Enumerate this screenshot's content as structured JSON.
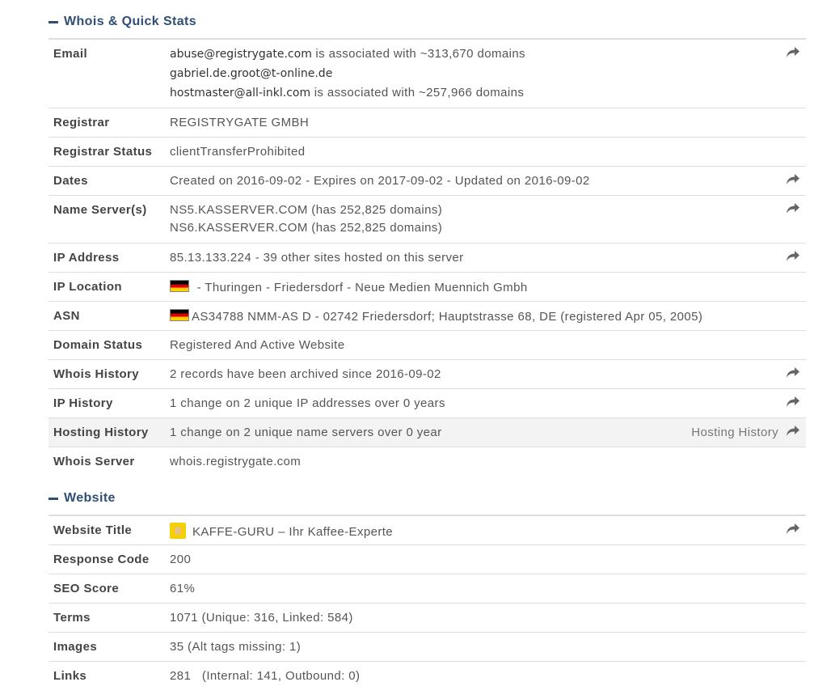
{
  "whois": {
    "title": "Whois & Quick Stats",
    "rows": {
      "email": {
        "label": "Email",
        "addr1": "abuse@registrygate.com",
        "assoc1": " is associated with ~313,670 domains",
        "addr2": "gabriel.de.groot@t-online.de",
        "addr3": "hostmaster@all-inkl.com",
        "assoc3": " is associated with ~257,966 domains"
      },
      "registrar": {
        "label": "Registrar",
        "value": "REGISTRYGATE GMBH"
      },
      "registrar_status": {
        "label": "Registrar Status",
        "value": "clientTransferProhibited"
      },
      "dates": {
        "label": "Dates",
        "value": "Created on 2016-09-02 - Expires on 2017-09-02 - Updated on 2016-09-02"
      },
      "name_servers": {
        "label": "Name Server(s)",
        "ns1": "NS5.KASSERVER.COM (has 252,825 domains)",
        "ns2": "NS6.KASSERVER.COM (has 252,825 domains)"
      },
      "ip_address": {
        "label": "IP Address",
        "value": "85.13.133.224 - 39 other sites hosted on this server"
      },
      "ip_location": {
        "label": "IP Location",
        "value": " - Thuringen - Friedersdorf - Neue Medien Muennich Gmbh",
        "flag": "germany-flag"
      },
      "asn": {
        "label": "ASN",
        "value": "AS34788 NMM-AS D - 02742 Friedersdorf; Hauptstrasse 68, DE (registered Apr 05, 2005)",
        "flag": "germany-flag"
      },
      "domain_status": {
        "label": "Domain Status",
        "value": "Registered And Active Website"
      },
      "whois_history": {
        "label": "Whois History",
        "value": "2 records have been archived since 2016-09-02"
      },
      "ip_history": {
        "label": "IP History",
        "value": "1 change on 2 unique IP addresses over 0 years"
      },
      "hosting_history": {
        "label": "Hosting History",
        "value": "1 change on 2 unique name servers over 0 year",
        "link": "Hosting History"
      },
      "whois_server": {
        "label": "Whois Server",
        "value": "whois.registrygate.com"
      }
    }
  },
  "website": {
    "title": "Website",
    "rows": {
      "title": {
        "label": "Website Title",
        "value": "KAFFE-GURU – Ihr Kaffee-Experte",
        "icon": "site-favicon"
      },
      "response_code": {
        "label": "Response Code",
        "value": "200"
      },
      "seo_score": {
        "label": "SEO Score",
        "value": "61%"
      },
      "terms": {
        "label": "Terms",
        "value": "1071 (Unique: 316, Linked: 584)"
      },
      "images": {
        "label": "Images",
        "value": "35 (Alt tags missing: 1)"
      },
      "links": {
        "label": "Links",
        "value": "281   (Internal: 141, Outbound: 0)"
      }
    }
  },
  "colors": {
    "section_title": "#2f4f75",
    "border": "#dddddd",
    "highlight_row": "#f3f3f3",
    "text": "#555555"
  },
  "icons": {
    "share": "share-arrow-icon",
    "collapse": "minus-icon"
  }
}
